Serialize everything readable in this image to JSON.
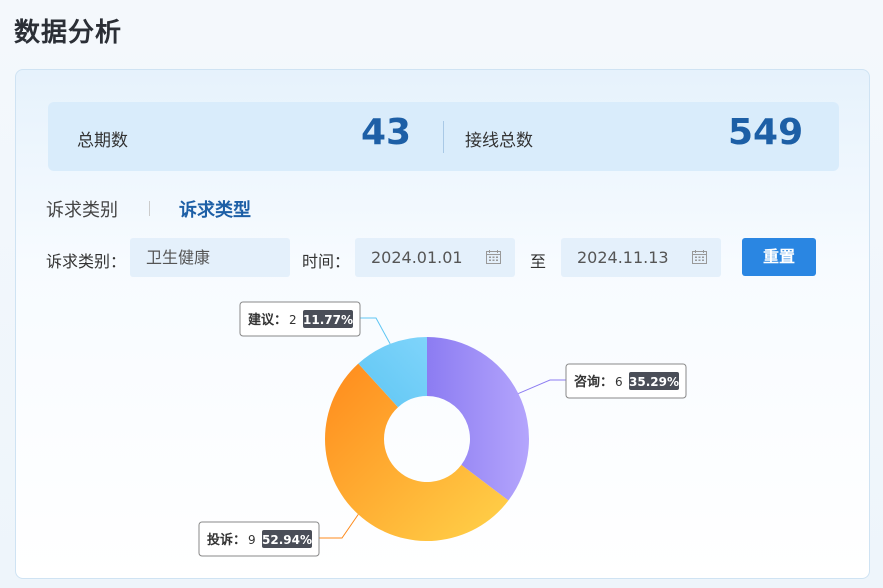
{
  "page": {
    "title": "数据分析"
  },
  "stats": {
    "periods_label": "总期数",
    "periods_value": "43",
    "calls_label": "接线总数",
    "calls_value": "549"
  },
  "tabs": [
    {
      "label": "诉求类别"
    },
    {
      "label": "诉求类型"
    }
  ],
  "filters": {
    "category_label": "诉求类别：",
    "category_value": "卫生健康",
    "time_label": "时间：",
    "start_date": "2024.01.01",
    "to_label": "至",
    "end_date": "2024.11.13",
    "reset_label": "重置"
  },
  "chart_data": {
    "type": "pie",
    "donut": true,
    "categories": [
      "咨询",
      "投诉",
      "建议"
    ],
    "values": [
      6,
      9,
      2
    ],
    "percent_labels": [
      "35.29%",
      "52.94%",
      "11.77%"
    ],
    "colors": [
      [
        "#8c7cf2",
        "#b4a5fc"
      ],
      [
        "#ff8a1c",
        "#ffd34a"
      ],
      [
        "#5fc6f3",
        "#7fd4fb"
      ]
    ],
    "legend": "none"
  }
}
